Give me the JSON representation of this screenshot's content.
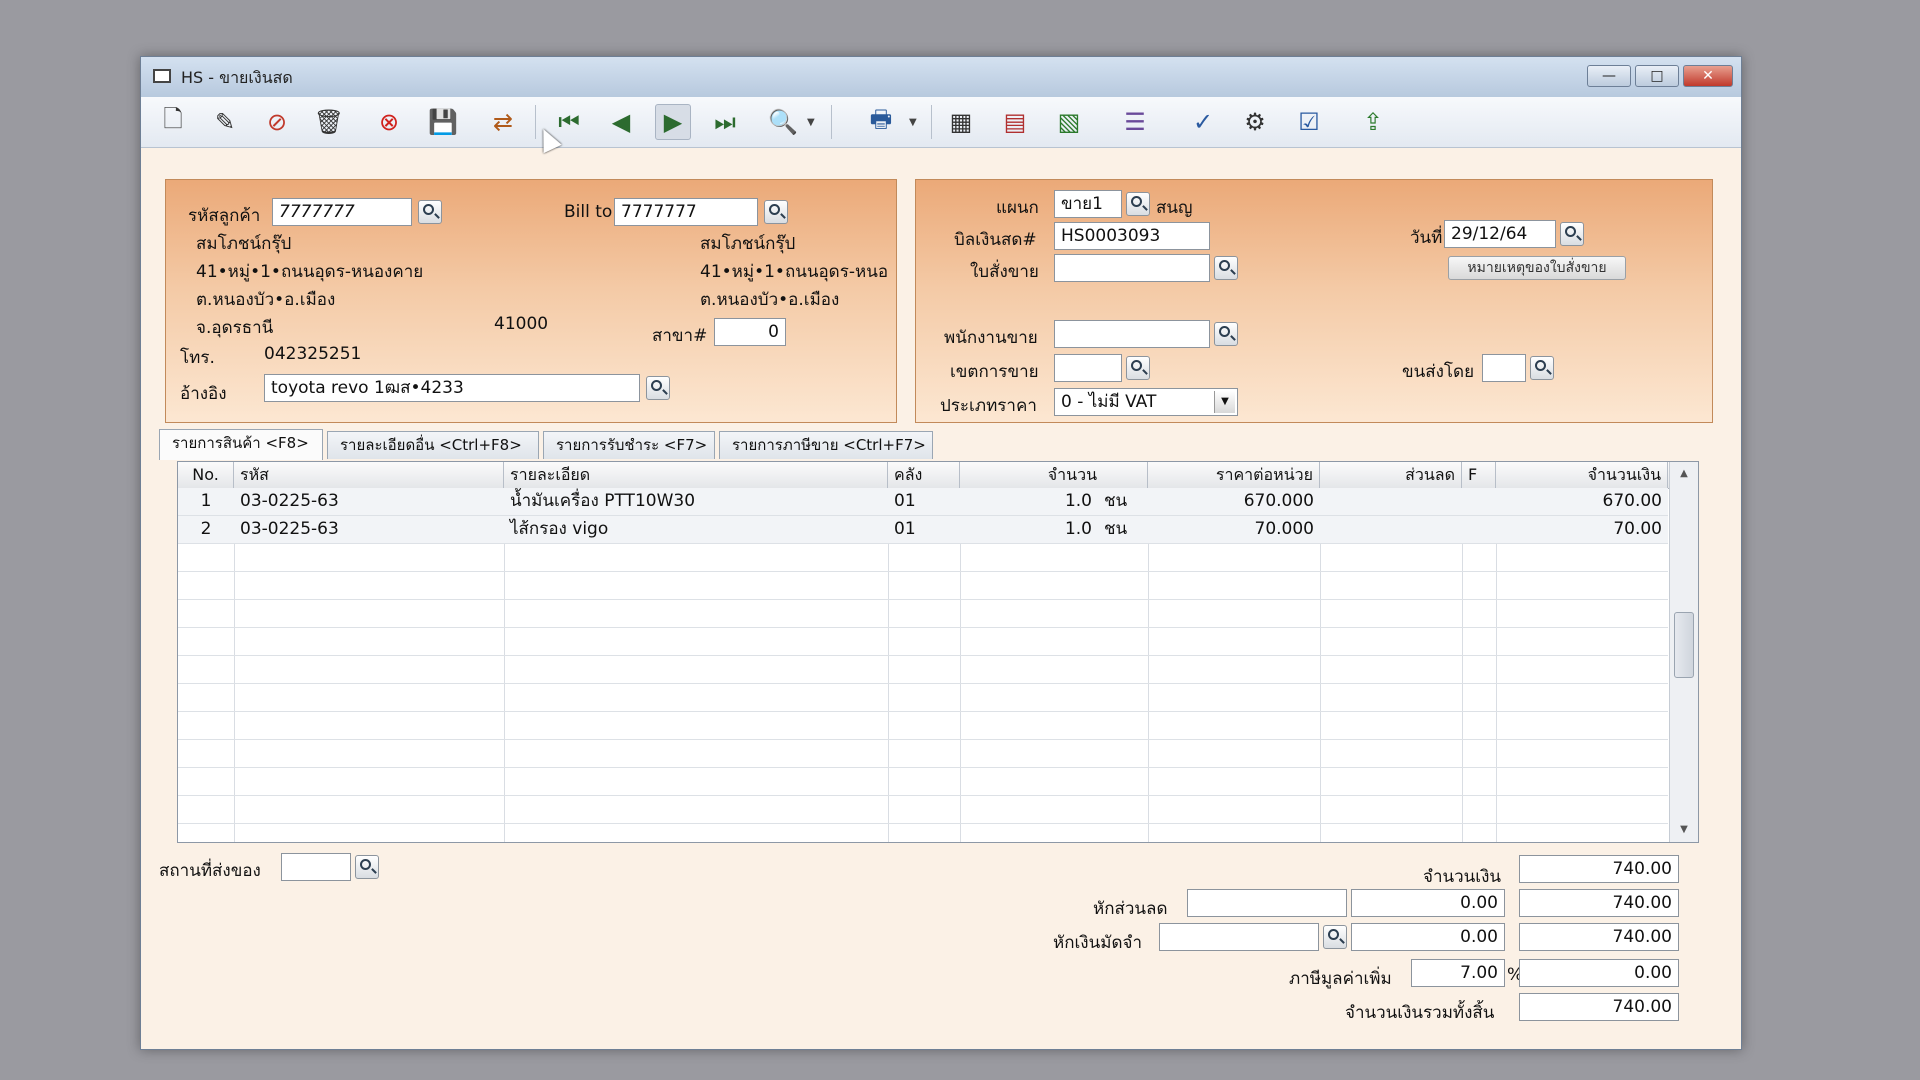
{
  "window": {
    "title": "HS - ขายเงินสด"
  },
  "customer": {
    "code_label": "รหัสลูกค้า",
    "code": "7777777",
    "bill_to_label": "Bill to",
    "bill_to": "7777777",
    "name": "สมโภชน์กรุ๊ป",
    "address1": "41•หมู่•1•ถนนอุดร-หนองคาย",
    "address2": "ต.หนองบัว•อ.เมือง",
    "province": "จ.อุดรธานี",
    "postcode": "41000",
    "phone_label": "โทร.",
    "phone": "042325251",
    "ref_label": "อ้างอิง",
    "ref": "toyota revo 1ฒส•4233",
    "billto_name": "สมโภชน์กรุ๊ป",
    "billto_address1": "41•หมู่•1•ถนนอุดร-หนอ",
    "billto_address2": "ต.หนองบัว•อ.เมือง",
    "branch_label": "สาขา#",
    "branch": "0"
  },
  "doc": {
    "dept_label": "แผนก",
    "dept": "ขาย1",
    "dept_name": "สนญ",
    "bill_label": "บิลเงินสด#",
    "bill_no": "HS0003093",
    "order_label": "ใบสั่งขาย",
    "order_no": "",
    "date_label": "วันที่",
    "date": "29/12/64",
    "note_button": "หมายเหตุของใบสั่งขาย",
    "sales_label": "พนักงานขาย",
    "sales": "",
    "area_label": "เขตการขาย",
    "area": "",
    "ship_label": "ขนส่งโดย",
    "ship": "",
    "pricetype_label": "ประเภทราคา",
    "pricetype": "0 - ไม่มี VAT"
  },
  "tabs": [
    "รายการสินค้า <F8>",
    "รายละเอียดอื่น <Ctrl+F8>",
    "รายการรับชำระ <F7>",
    "รายการภาษีขาย <Ctrl+F7>"
  ],
  "grid": {
    "headers": [
      "No.",
      "รหัส",
      "รายละเอียด",
      "คลัง",
      "จำนวน",
      "ราคาต่อหน่วย",
      "ส่วนลด",
      "F",
      "จำนวนเงิน"
    ],
    "rows": [
      {
        "no": "1",
        "code": "03-0225-63",
        "desc": "น้ำมันเครื่อง PTT10W30",
        "wh": "01",
        "qty": "1.0",
        "unit": "ชน",
        "price": "670.000",
        "disc": "",
        "f": "",
        "amount": "670.00"
      },
      {
        "no": "2",
        "code": "03-0225-63",
        "desc": "ไส้กรอง vigo",
        "wh": "01",
        "qty": "1.0",
        "unit": "ชน",
        "price": "70.000",
        "disc": "",
        "f": "",
        "amount": "70.00"
      }
    ]
  },
  "footer": {
    "ship_place_label": "สถานที่ส่งของ",
    "ship_place": "",
    "amount_label": "จำนวนเงิน",
    "amount": "740.00",
    "discount_label": "หักส่วนลด",
    "discount_input": "",
    "discount_value": "0.00",
    "after_discount": "740.00",
    "deposit_label": "หักเงินมัดจำ",
    "deposit_input": "",
    "deposit_value": "0.00",
    "after_deposit": "740.00",
    "vat_label": "ภาษีมูลค่าเพิ่ม",
    "vat_rate": "7.00",
    "vat_unit": "%",
    "vat_amount": "0.00",
    "total_label": "จำนวนเงินรวมทั้งสิ้น",
    "total": "740.00"
  },
  "colors": {
    "panel": "#f4caa6",
    "panel_top": "#eba978",
    "window_bg": "#fbf1e6"
  }
}
